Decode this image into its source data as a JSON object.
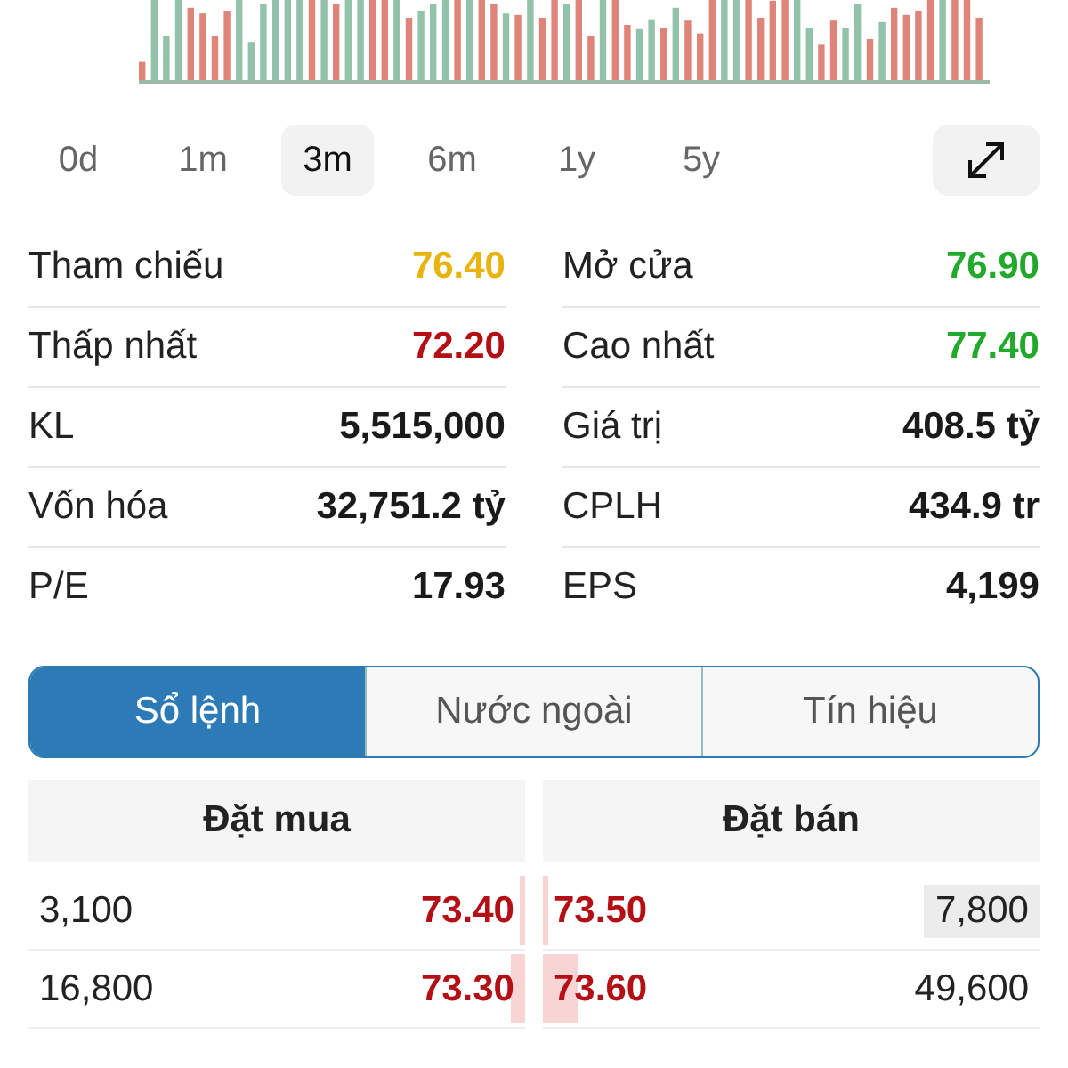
{
  "periods": [
    {
      "label": "0d",
      "selected": false
    },
    {
      "label": "1m",
      "selected": false
    },
    {
      "label": "3m",
      "selected": true
    },
    {
      "label": "6m",
      "selected": false
    },
    {
      "label": "1y",
      "selected": false
    },
    {
      "label": "5y",
      "selected": false
    }
  ],
  "stats": [
    {
      "label": "Tham chiếu",
      "value": "76.40",
      "color": "#e8b30c"
    },
    {
      "label": "Mở cửa",
      "value": "76.90",
      "color": "#22a82a"
    },
    {
      "label": "Thấp nhất",
      "value": "72.20",
      "color": "#b30f14"
    },
    {
      "label": "Cao nhất",
      "value": "77.40",
      "color": "#22a82a"
    },
    {
      "label": "KL",
      "value": "5,515,000",
      "color": "#1a1a1a"
    },
    {
      "label": "Giá trị",
      "value": "408.5 tỷ",
      "color": "#1a1a1a"
    },
    {
      "label": "Vốn hóa",
      "value": "32,751.2 tỷ",
      "color": "#1a1a1a"
    },
    {
      "label": "CPLH",
      "value": "434.9 tr",
      "color": "#1a1a1a"
    },
    {
      "label": "P/E",
      "value": "17.93",
      "color": "#1a1a1a"
    },
    {
      "label": "EPS",
      "value": "4,199",
      "color": "#1a1a1a"
    }
  ],
  "segments": [
    {
      "label": "Sổ lệnh",
      "selected": true
    },
    {
      "label": "Nước ngoài",
      "selected": false
    },
    {
      "label": "Tín hiệu",
      "selected": false
    }
  ],
  "order_book": {
    "columns": [
      "Đặt mua",
      "Đặt bán"
    ],
    "rows": [
      {
        "bid_volume": "3,100",
        "bid_price": "73.40",
        "bid_bar": {
          "level": 0.01
        },
        "ask_price": "73.50",
        "ask_bar": {
          "level": 0.01
        },
        "ask_volume": "7,800",
        "ask_highlighted": true
      },
      {
        "bid_volume": "16,800",
        "bid_price": "73.30",
        "bid_bar": {
          "level": 0.03
        },
        "ask_price": "73.60",
        "ask_bar": {
          "level": 0.07
        },
        "ask_volume": "49,600",
        "ask_highlighted": false
      }
    ]
  }
}
